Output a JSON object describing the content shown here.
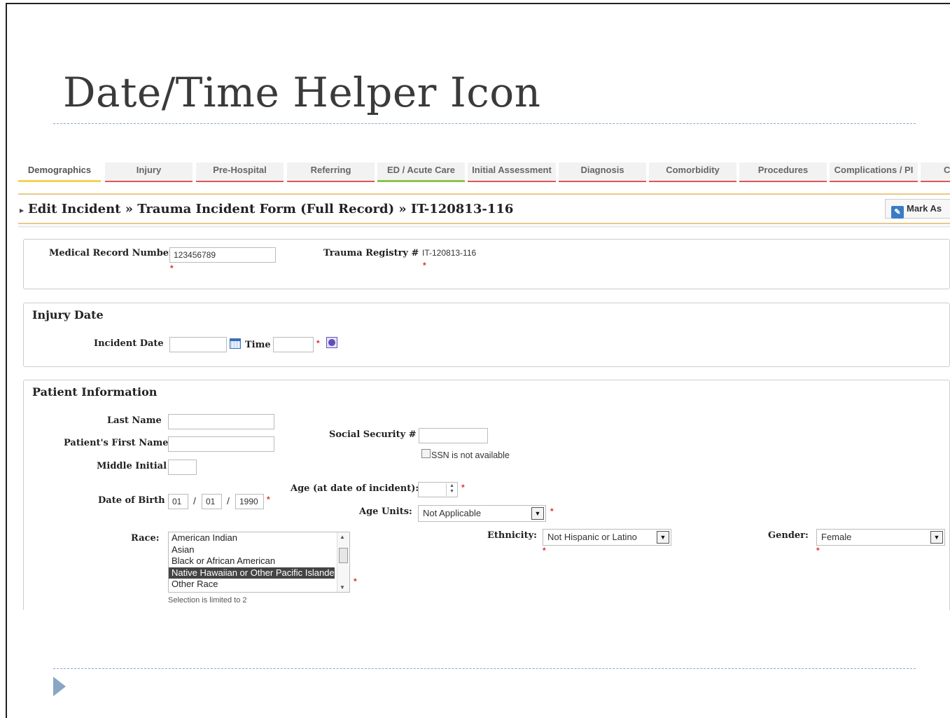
{
  "slide": {
    "title": "Date/Time Helper Icon"
  },
  "tabs": [
    {
      "label": "Demographics"
    },
    {
      "label": "Injury"
    },
    {
      "label": "Pre-Hospital"
    },
    {
      "label": "Referring"
    },
    {
      "label": "ED / Acute Care"
    },
    {
      "label": "Initial Assessment"
    },
    {
      "label": "Diagnosis"
    },
    {
      "label": "Comorbidity"
    },
    {
      "label": "Procedures"
    },
    {
      "label": "Complications / PI"
    },
    {
      "label": "C"
    }
  ],
  "header": {
    "breadcrumb": "Edit Incident » Trauma Incident Form (Full Record) » IT-120813-116",
    "mark_as": "Mark As"
  },
  "record": {
    "mrn_label": "Medical Record Number",
    "mrn_value": "123456789",
    "registry_label": "Trauma Registry #",
    "registry_value": "IT-120813-116"
  },
  "injury_date": {
    "title": "Injury Date",
    "incident_date_label": "Incident Date",
    "incident_date_value": "",
    "time_label": "Time",
    "time_value": ""
  },
  "patient": {
    "title": "Patient Information",
    "last_name_label": "Last Name",
    "first_name_label": "Patient's First Name",
    "middle_initial_label": "Middle Initial",
    "dob_label": "Date of Birth",
    "dob_month": "01",
    "dob_day": "01",
    "dob_year": "1990",
    "dob_sep": "/",
    "ssn_label": "Social Security #",
    "ssn_na_label": "SSN is not available",
    "age_label": "Age (at date of incident):",
    "age_units_label": "Age Units:",
    "age_units_value": "Not Applicable",
    "race_label": "Race:",
    "race_options": [
      {
        "label": "American Indian",
        "selected": false
      },
      {
        "label": "Asian",
        "selected": false
      },
      {
        "label": "Black or African American",
        "selected": false
      },
      {
        "label": "Native Hawaiian or Other Pacific Islander",
        "selected": true
      },
      {
        "label": "Other Race",
        "selected": false
      }
    ],
    "race_hint": "Selection is limited to 2",
    "ethnicity_label": "Ethnicity:",
    "ethnicity_value": "Not Hispanic or Latino",
    "gender_label": "Gender:",
    "gender_value": "Female"
  },
  "required_mark": "*"
}
